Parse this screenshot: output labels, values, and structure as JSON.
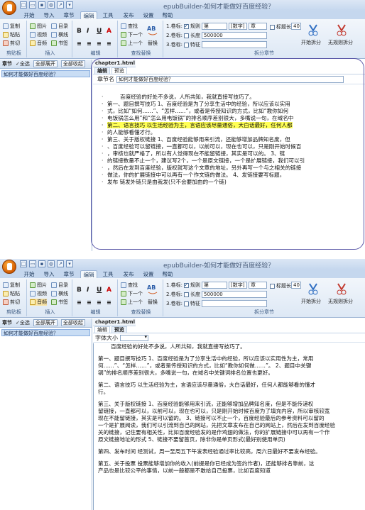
{
  "app": {
    "title": "epubBuilder-如何才能做好百度经验？"
  },
  "tabs": [
    "开始",
    "导入",
    "章节",
    "编辑",
    "工具",
    "发布",
    "设置",
    "帮助"
  ],
  "active_tab": "编辑",
  "ribbon": {
    "clipboard": {
      "label": "剪贴板",
      "copy": "复制",
      "paste": "粘贴",
      "cut": "剪切"
    },
    "insert": {
      "label": "插入",
      "image": "图片",
      "video": "视频",
      "audio": "音频",
      "toc": "目录",
      "hr": "横线",
      "bookmark": "书签"
    },
    "edit": {
      "label": "编辑",
      "bold": "B",
      "italic": "I",
      "underline": "U",
      "color": "A"
    },
    "find": {
      "label": "查找替换",
      "find": "查找",
      "next": "下一个",
      "prev": "上一个",
      "replace": "替换"
    },
    "split": {
      "label": "拆分章节",
      "level1": "1.卷标:",
      "level2": "2.卷标:",
      "level3": "3.卷标:",
      "rule": "规则",
      "length": "长度",
      "feature": "特征",
      "prefix": "第",
      "numtype": "[数字]",
      "suffix": "章",
      "title_len_label": "标题长度≤",
      "title_len": "40",
      "char_unit": "字符",
      "len_value": "500000",
      "start": "开始拆分",
      "nosplit": "无规则拆分"
    }
  },
  "left_panel": {
    "header": "章节",
    "select_all": "全选",
    "expand_all": "全部展开",
    "collapse_all": "全部收起",
    "items": [
      "如何才能做好百度经验？"
    ]
  },
  "doc": {
    "file_tab": "chapter1.html",
    "subtab_edit": "编辑",
    "subtab_preview": "预览",
    "chapter_name_label": "章节名",
    "chapter_name_value": "如何才能做好百度经验？",
    "font_size_label": "字体大小"
  },
  "screen1_lines": [
    {
      "text": "百度经验的好处不多说，人所共知，我就直接写技巧了。",
      "indent": true
    },
    {
      "text": ""
    },
    {
      "text": "第一、题目撰写技巧      1、百度经验是为了分享生活中的经验，所以应该以实用"
    },
    {
      "text": "式，比如“如何……”、“怎样……”，或者是传授知识的方式，比如“教你如何"
    },
    {
      "text": "电饭锅怎么用”和“怎么用电饭锅”的排名顺序差别很大，多嘴说一句，在域名中"
    },
    {
      "text": ""
    },
    {
      "text": "第二、语言技巧     以生活经验为主，言语应该尽量通俗，大白话最好，任何人都",
      "hl": true
    },
    {
      "text": "的人能够看懂才行。"
    },
    {
      "text": ""
    },
    {
      "text": "第三、关于版权链接       1、百度经验能够用来引流，还能够增加品牌知名度，但"
    },
    {
      "text": "、百度经验可以留链接，一直都可以，以前可以，现在也可以，只是刚开始时候百"
    },
    {
      "text": "，审核也就严格了，所以有人觉得现在不能留链接，其实是可以的。        3、链"
    },
    {
      "text": "的链接数量不止一个，建议写2个，一个是原文链接，一个是扩展链接，我们可以引"
    },
    {
      "text": "，然后在发到百度经验，版权就写这个文章的地址，另外再写一个与之相关的链接"
    },
    {
      "text": "做法，你的扩展链接中可以再有一个作文链的做法。     4、发链接要写标题，"
    },
    {
      "text": "发布   链发外链只是由我发(只不会要加由的一个链)"
    }
  ],
  "screen2_lines": [
    "百度经验的好处不多说，人所共知，我就直接写技巧了。",
    "",
    "第一、题目撰写技巧      1、百度经验是为了分享生活中的经验，所以应该以实用性为主，常用",
    "何……”、“怎样……”，或者是传授知识的方式，比如“教你如何做……”。      2、题目中关键",
    "锅”的排名顺序差别很大，多嘴说一句，在域名中关键词排名位置也更好。",
    "",
    "第二、语言技巧     以生活经验为主，言语应该尽量通俗，大白话最好，任何人都能够看的懂才",
    "行。",
    "",
    "第三、关于版权链接      1、百度经验能够用来引流，还能够增加品牌知名度，但是不能传递权",
    "留链接，一直都可以，以前可以，现在也可以，只是刚开始时候百度为了填充内容，所以审核较宽",
    "现在不能留链接，其实是可以留的。    3、链接可以不止一个，百度经验最后的参考资料可以留的",
    "一个是扩展阅读，我们可以引流到自己的网站，先把文章发布在自己的网站上，然后在发到百度经验",
    "关的链接，记住要有相关性，比如百度经验发的是作鸡翅的做法，你的扩展链接中可以再有一个作",
    "原文链接地址的形式      5、链接不要留首页，除非你是单页形式(最好别使用单页)",
    "",
    "第四、发布时间      经测试，周一至周五下午发表经验通过率比较高，周六日最好不要发布经验。",
    "",
    "第五、关于投票      投票能够增加你的收入(前提是你已经成为签约作者)，还能够排名靠前，这",
    "产品也是比较公平的事情，以前一般都是不敢给自己投票，比如百度知道"
  ]
}
